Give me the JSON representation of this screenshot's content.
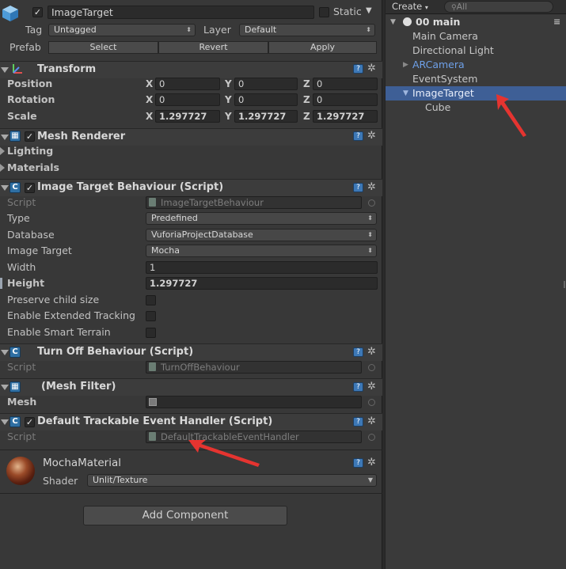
{
  "inspector": {
    "header": {
      "active_checked": true,
      "name_value": "ImageTarget",
      "static_label": "Static",
      "tag_label": "Tag",
      "tag_value": "Untagged",
      "layer_label": "Layer",
      "layer_value": "Default",
      "prefab_label": "Prefab",
      "prefab_select": "Select",
      "prefab_revert": "Revert",
      "prefab_apply": "Apply"
    },
    "transform": {
      "title": "Transform",
      "position_label": "Position",
      "rotation_label": "Rotation",
      "scale_label": "Scale",
      "axis_x": "X",
      "axis_y": "Y",
      "axis_z": "Z",
      "position": {
        "x": "0",
        "y": "0",
        "z": "0"
      },
      "rotation": {
        "x": "0",
        "y": "0",
        "z": "0"
      },
      "scale": {
        "x": "1.297727",
        "y": "1.297727",
        "z": "1.297727"
      }
    },
    "mesh_renderer": {
      "title": "Mesh Renderer",
      "lighting_label": "Lighting",
      "materials_label": "Materials"
    },
    "image_target_behaviour": {
      "title": "Image Target Behaviour (Script)",
      "script_label": "Script",
      "script_value": "ImageTargetBehaviour",
      "type_label": "Type",
      "type_value": "Predefined",
      "database_label": "Database",
      "database_value": "VuforiaProjectDatabase",
      "image_target_label": "Image Target",
      "image_target_value": "Mocha",
      "width_label": "Width",
      "width_value": "1",
      "height_label": "Height",
      "height_value": "1.297727",
      "preserve_label": "Preserve child size",
      "extended_label": "Enable Extended Tracking",
      "smart_label": "Enable Smart Terrain"
    },
    "turn_off_behaviour": {
      "title": "Turn Off Behaviour (Script)",
      "script_label": "Script",
      "script_value": "TurnOffBehaviour"
    },
    "mesh_filter": {
      "title": "(Mesh Filter)",
      "mesh_label": "Mesh"
    },
    "default_trackable": {
      "title": "Default Trackable Event Handler (Script)",
      "script_label": "Script",
      "script_value": "DefaultTrackableEventHandler"
    },
    "material": {
      "name": "MochaMaterial",
      "shader_label": "Shader",
      "shader_value": "Unlit/Texture"
    },
    "add_component_label": "Add Component"
  },
  "hierarchy": {
    "create_label": "Create",
    "search_placeholder": "All",
    "scene_name": "00 main",
    "items": [
      {
        "label": "Main Camera"
      },
      {
        "label": "Directional Light"
      },
      {
        "label": "ARCamera"
      },
      {
        "label": "EventSystem"
      },
      {
        "label": "ImageTarget"
      },
      {
        "label": "Cube"
      }
    ]
  },
  "colors": {
    "selection": "#3e5f96",
    "prefab_blue": "#6ea0e8",
    "annotation_red": "#e53430",
    "panel_bg": "#383838"
  }
}
